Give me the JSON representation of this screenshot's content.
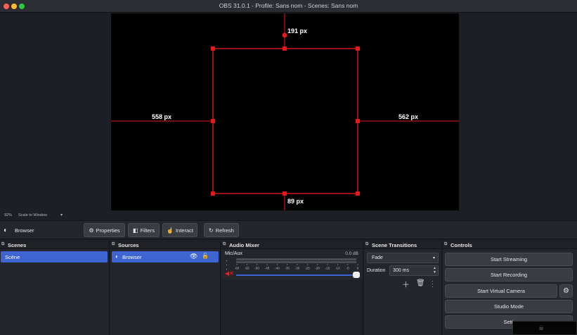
{
  "window": {
    "title": "OBS 31.0.1 - Profile: Sans nom - Scenes: Sans nom"
  },
  "preview": {
    "guides": {
      "top": "191 px",
      "left": "558 px",
      "right": "562 px",
      "bottom": "89 px"
    },
    "zoom": "92%",
    "zoom_mode": "Scale to Window"
  },
  "source_toolbar": {
    "source_name": "Browser",
    "properties_label": "Properties",
    "filters_label": "Filters",
    "interact_label": "Interact",
    "refresh_label": "Refresh"
  },
  "docks": {
    "scenes": {
      "title": "Scenes",
      "items": [
        "Scène"
      ]
    },
    "sources": {
      "title": "Sources",
      "items": [
        "Browser"
      ]
    },
    "audio_mixer": {
      "title": "Audio Mixer",
      "channel": "Mic/Aux",
      "level": "0.0 dB",
      "ticks": [
        "-60",
        "-55",
        "-50",
        "-45",
        "-40",
        "-35",
        "-30",
        "-25",
        "-20",
        "-15",
        "-10",
        "-5",
        "0"
      ],
      "volume_fraction": 1.0,
      "muted": true
    },
    "scene_transitions": {
      "title": "Scene Transitions",
      "transition": "Fade",
      "duration_label": "Duration",
      "duration_value": "300 ms"
    },
    "controls": {
      "title": "Controls",
      "start_streaming": "Start Streaming",
      "start_recording": "Start Recording",
      "start_virtual_camera": "Start Virtual Camera",
      "studio_mode": "Studio Mode",
      "settings": "Setti"
    }
  },
  "colors": {
    "accent": "#3d64d1",
    "guide": "#e11a1a",
    "mute": "#e02828"
  }
}
